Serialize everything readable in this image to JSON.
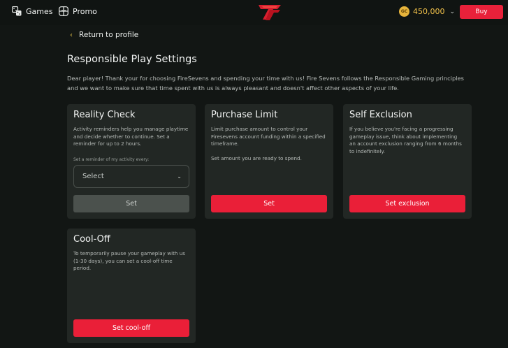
{
  "header": {
    "nav": [
      {
        "label": "Games",
        "icon": "dice-icon"
      },
      {
        "label": "Promo",
        "icon": "gift-icon"
      }
    ],
    "logo_icon": "firesevens-logo",
    "balance": {
      "coin_label": "GC",
      "amount": "450,000"
    },
    "buy_label": "Buy"
  },
  "back_label": "Return to profile",
  "page_title": "Responsible Play Settings",
  "intro": "Dear player! Thank your for choosing FireSevens and spending your time with us! Fire Sevens follows the Responsible Gaming principles and we want to make sure that time spent with us is always pleasant and doesn't affect other aspects of your life.",
  "cards": {
    "reality_check": {
      "title": "Reality Check",
      "description": "Activity reminders help you manage playtime and decide whether to continue. Set a reminder for up to 2 hours.",
      "select_label": "Set a reminder of my activity every:",
      "select_value": "Select",
      "button": "Set"
    },
    "purchase_limit": {
      "title": "Purchase Limit",
      "description": "Limit purchase amount to control your Firesevens account funding within a specified timeframe.",
      "description2": "Set amount you are ready to spend.",
      "button": "Set"
    },
    "self_exclusion": {
      "title": "Self Exclusion",
      "description": "If you believe you're facing a progressing gameplay issue, think about implementing an account exclusion ranging from 6 months to indefinitely.",
      "button": "Set exclusion"
    },
    "cool_off": {
      "title": "Cool-Off",
      "description": "To temporarily pause your gameplay with us (1-30 days), you can set a cool-off time period.",
      "button": "Set cool-off"
    }
  },
  "colors": {
    "accent": "#ea1f38",
    "coin": "#e7b43b",
    "background": "#121614",
    "card": "#222724"
  }
}
